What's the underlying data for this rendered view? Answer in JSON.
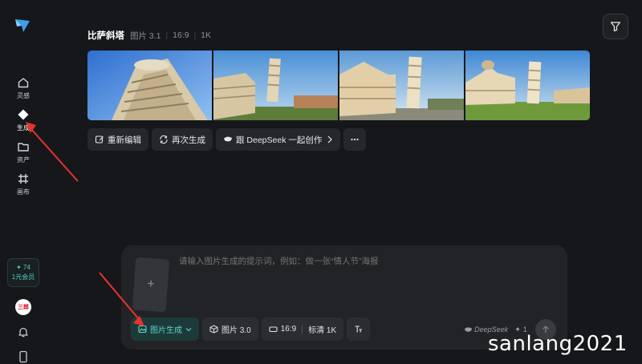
{
  "sidebar": {
    "items": [
      {
        "label": "灵感",
        "icon": "home-icon"
      },
      {
        "label": "生成",
        "icon": "sparkle-diamond-icon"
      },
      {
        "label": "资产",
        "icon": "folder-icon"
      },
      {
        "label": "画布",
        "icon": "canvas-grid-icon"
      }
    ],
    "credits": {
      "value": "✦ 74",
      "label": "1元会员"
    },
    "avatar_text": "三郎"
  },
  "header": {
    "title": "比萨斜塔",
    "model": "图片 3.1",
    "ratio": "16:9",
    "resolution": "1K"
  },
  "actions": [
    {
      "label": "重新编辑",
      "icon": "edit-icon"
    },
    {
      "label": "再次生成",
      "icon": "refresh-icon"
    },
    {
      "label": "跟 DeepSeek 一起创作",
      "icon": "deepseek-icon"
    },
    {
      "label": "",
      "icon": "more-icon"
    }
  ],
  "composer": {
    "placeholder": "请输入图片生成的提示词，例如：做一张“情人节”海报",
    "mode_label": "图片生成",
    "model_label": "图片 3.0",
    "ratio": "16:9",
    "quality": "标清 1K",
    "deepseek_label": "DeepSeek",
    "count": "✦ 1"
  },
  "watermark": "sanlang2021",
  "colors": {
    "accent": "#4fd1c5",
    "background": "#16171b",
    "annotation": "#e8322d"
  }
}
